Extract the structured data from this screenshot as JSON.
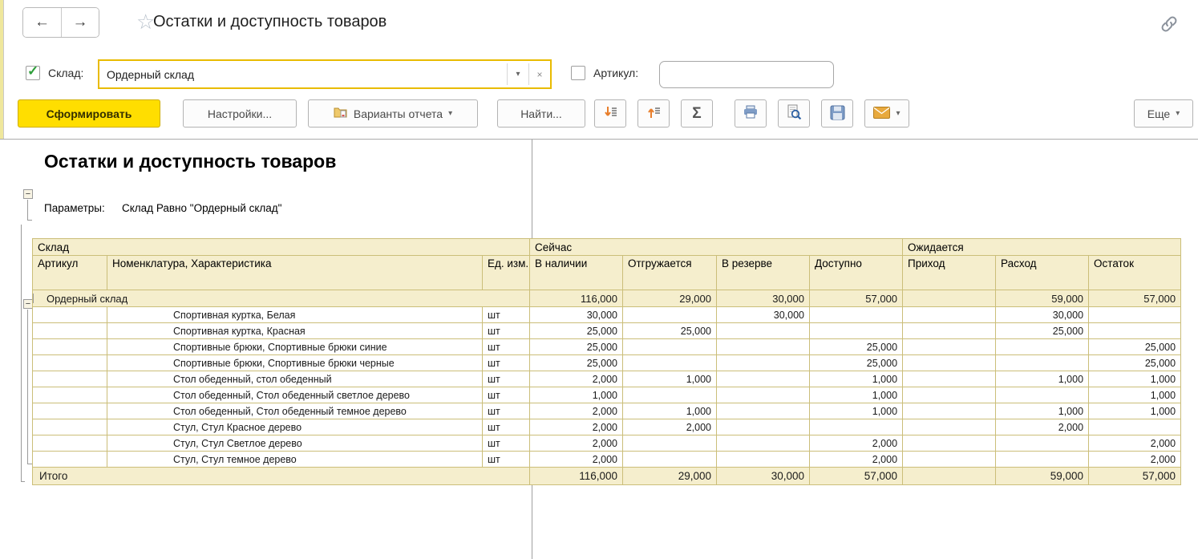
{
  "window": {
    "title": "Остатки и доступность товаров"
  },
  "icons": {
    "back": "←",
    "forward": "→",
    "star": "☆",
    "caret": "▾",
    "clear": "×",
    "sigma": "Σ",
    "collapse": "−",
    "check": "✓"
  },
  "filters": {
    "sklad": {
      "label": "Склад:",
      "value": "Ордерный склад",
      "checked": true
    },
    "artikul": {
      "label": "Артикул:",
      "value": "",
      "checked": false
    }
  },
  "toolbar": {
    "generate": "Сформировать",
    "settings": "Настройки...",
    "variants": "Варианты отчета",
    "find": "Найти...",
    "more": "Еще"
  },
  "report": {
    "title": "Остатки и доступность товаров",
    "params_label": "Параметры:",
    "params_value": "Склад Равно \"Ордерный склад\""
  },
  "table": {
    "groups": [
      "Склад",
      "Сейчас",
      "Ожидается"
    ],
    "columns": [
      "Артикул",
      "Номенклатура, Характеристика",
      "Ед. изм.",
      "В наличии",
      "Отгружается",
      "В резерве",
      "Доступно",
      "Приход",
      "Расход",
      "Остаток"
    ],
    "group_row": {
      "label": "Ордерный склад",
      "values": [
        "116,000",
        "29,000",
        "30,000",
        "57,000",
        "",
        "59,000",
        "57,000"
      ]
    },
    "rows": [
      {
        "name": "Спортивная куртка, Белая",
        "unit": "шт",
        "values": [
          "30,000",
          "",
          "30,000",
          "",
          "",
          "30,000",
          ""
        ]
      },
      {
        "name": "Спортивная куртка, Красная",
        "unit": "шт",
        "values": [
          "25,000",
          "25,000",
          "",
          "",
          "",
          "25,000",
          ""
        ]
      },
      {
        "name": "Спортивные брюки, Спортивные брюки синие",
        "unit": "шт",
        "values": [
          "25,000",
          "",
          "",
          "25,000",
          "",
          "",
          "25,000"
        ]
      },
      {
        "name": "Спортивные брюки, Спортивные брюки черные",
        "unit": "шт",
        "values": [
          "25,000",
          "",
          "",
          "25,000",
          "",
          "",
          "25,000"
        ]
      },
      {
        "name": "Стол обеденный, стол обеденный",
        "unit": "шт",
        "values": [
          "2,000",
          "1,000",
          "",
          "1,000",
          "",
          "1,000",
          "1,000"
        ]
      },
      {
        "name": "Стол обеденный, Стол обеденный светлое дерево",
        "unit": "шт",
        "values": [
          "1,000",
          "",
          "",
          "1,000",
          "",
          "",
          "1,000"
        ]
      },
      {
        "name": "Стол обеденный, Стол обеденный темное дерево",
        "unit": "шт",
        "values": [
          "2,000",
          "1,000",
          "",
          "1,000",
          "",
          "1,000",
          "1,000"
        ]
      },
      {
        "name": "Стул, Стул Красное дерево",
        "unit": "шт",
        "values": [
          "2,000",
          "2,000",
          "",
          "",
          "",
          "2,000",
          ""
        ]
      },
      {
        "name": "Стул, Стул Светлое дерево",
        "unit": "шт",
        "values": [
          "2,000",
          "",
          "",
          "2,000",
          "",
          "",
          "2,000"
        ]
      },
      {
        "name": "Стул, Стул темное дерево",
        "unit": "шт",
        "values": [
          "2,000",
          "",
          "",
          "2,000",
          "",
          "",
          "2,000"
        ]
      }
    ],
    "total": {
      "label": "Итого",
      "values": [
        "116,000",
        "29,000",
        "30,000",
        "57,000",
        "",
        "59,000",
        "57,000"
      ]
    }
  },
  "colors": {
    "accent_yellow": "#FFDE00",
    "field_border": "#E9BB00",
    "header_fill": "#F5EECD",
    "grid_tan": "#C3B46A",
    "icon_orange": "#E87E2B"
  }
}
